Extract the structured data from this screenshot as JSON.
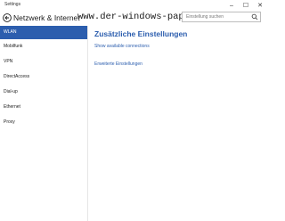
{
  "window": {
    "title": "Settings",
    "controls": [
      "–",
      "☐",
      "✕"
    ]
  },
  "header": {
    "title": "Netzwerk & Internet",
    "watermark": "www.der-windows-papst.de"
  },
  "search": {
    "placeholder": "Einstellung suchen"
  },
  "sidebar": {
    "items": [
      {
        "label": "WLAN",
        "active": true
      },
      {
        "label": "Mobilfunk"
      },
      {
        "label": "VPN"
      },
      {
        "label": "DirectAccess"
      },
      {
        "label": "Dial-up"
      },
      {
        "label": "Ethernet"
      },
      {
        "label": "Proxy"
      }
    ]
  },
  "main": {
    "section_title": "Zusätzliche Einstellungen",
    "links": [
      "Show available connections",
      "Erweiterte Einstellungen"
    ]
  },
  "colors": {
    "accent": "#2c5eae",
    "background": "#ffffff"
  },
  "icons": {
    "back": "back-arrow-icon",
    "search": "search-icon"
  }
}
